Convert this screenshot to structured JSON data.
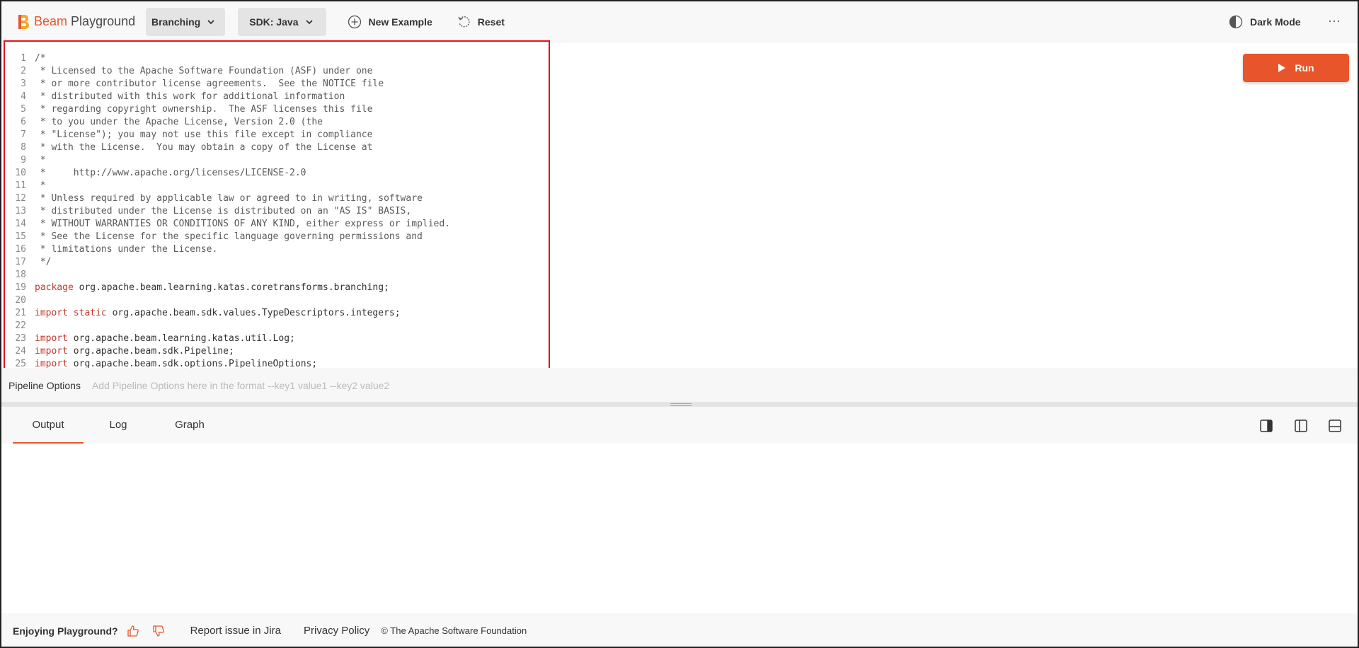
{
  "header": {
    "logo_brand": "Beam",
    "logo_product": "Playground",
    "example_dropdown": "Branching",
    "sdk_dropdown": "SDK: Java",
    "new_example": "New Example",
    "reset": "Reset",
    "dark_mode": "Dark Mode",
    "more": "⋯"
  },
  "editor": {
    "run_label": "Run",
    "lines": [
      {
        "n": "1",
        "t": "/*"
      },
      {
        "n": "2",
        "t": " * Licensed to the Apache Software Foundation (ASF) under one"
      },
      {
        "n": "3",
        "t": " * or more contributor license agreements.  See the NOTICE file"
      },
      {
        "n": "4",
        "t": " * distributed with this work for additional information"
      },
      {
        "n": "5",
        "t": " * regarding copyright ownership.  The ASF licenses this file"
      },
      {
        "n": "6",
        "t": " * to you under the Apache License, Version 2.0 (the"
      },
      {
        "n": "7",
        "t": " * \"License\"); you may not use this file except in compliance"
      },
      {
        "n": "8",
        "t": " * with the License.  You may obtain a copy of the License at"
      },
      {
        "n": "9",
        "t": " *"
      },
      {
        "n": "10",
        "t": " *     http://www.apache.org/licenses/LICENSE-2.0"
      },
      {
        "n": "11",
        "t": " *"
      },
      {
        "n": "12",
        "t": " * Unless required by applicable law or agreed to in writing, software"
      },
      {
        "n": "13",
        "t": " * distributed under the License is distributed on an \"AS IS\" BASIS,"
      },
      {
        "n": "14",
        "t": " * WITHOUT WARRANTIES OR CONDITIONS OF ANY KIND, either express or implied."
      },
      {
        "n": "15",
        "t": " * See the License for the specific language governing permissions and"
      },
      {
        "n": "16",
        "t": " * limitations under the License."
      },
      {
        "n": "17",
        "t": " */"
      },
      {
        "n": "18",
        "t": ""
      },
      {
        "n": "19",
        "kw": "package",
        "t": " org.apache.beam.learning.katas.coretransforms.branching;"
      },
      {
        "n": "20",
        "t": ""
      },
      {
        "n": "21",
        "kw": "import static",
        "t": " org.apache.beam.sdk.values.TypeDescriptors.integers;"
      },
      {
        "n": "22",
        "t": ""
      },
      {
        "n": "23",
        "kw": "import",
        "t": " org.apache.beam.learning.katas.util.Log;"
      },
      {
        "n": "24",
        "kw": "import",
        "t": " org.apache.beam.sdk.Pipeline;"
      },
      {
        "n": "25",
        "kw": "import",
        "t": " org.apache.beam.sdk.options.PipelineOptions;"
      }
    ]
  },
  "pipeline": {
    "label": "Pipeline Options",
    "placeholder": "Add Pipeline Options here in the format --key1 value1 --key2 value2"
  },
  "output": {
    "tabs": [
      "Output",
      "Log",
      "Graph"
    ]
  },
  "footer": {
    "enjoying": "Enjoying Playground?",
    "report": "Report issue in Jira",
    "privacy": "Privacy Policy",
    "copyright": "© The Apache Software Foundation"
  },
  "colors": {
    "accent": "#e8552a",
    "highlight_border": "#e0141c"
  }
}
